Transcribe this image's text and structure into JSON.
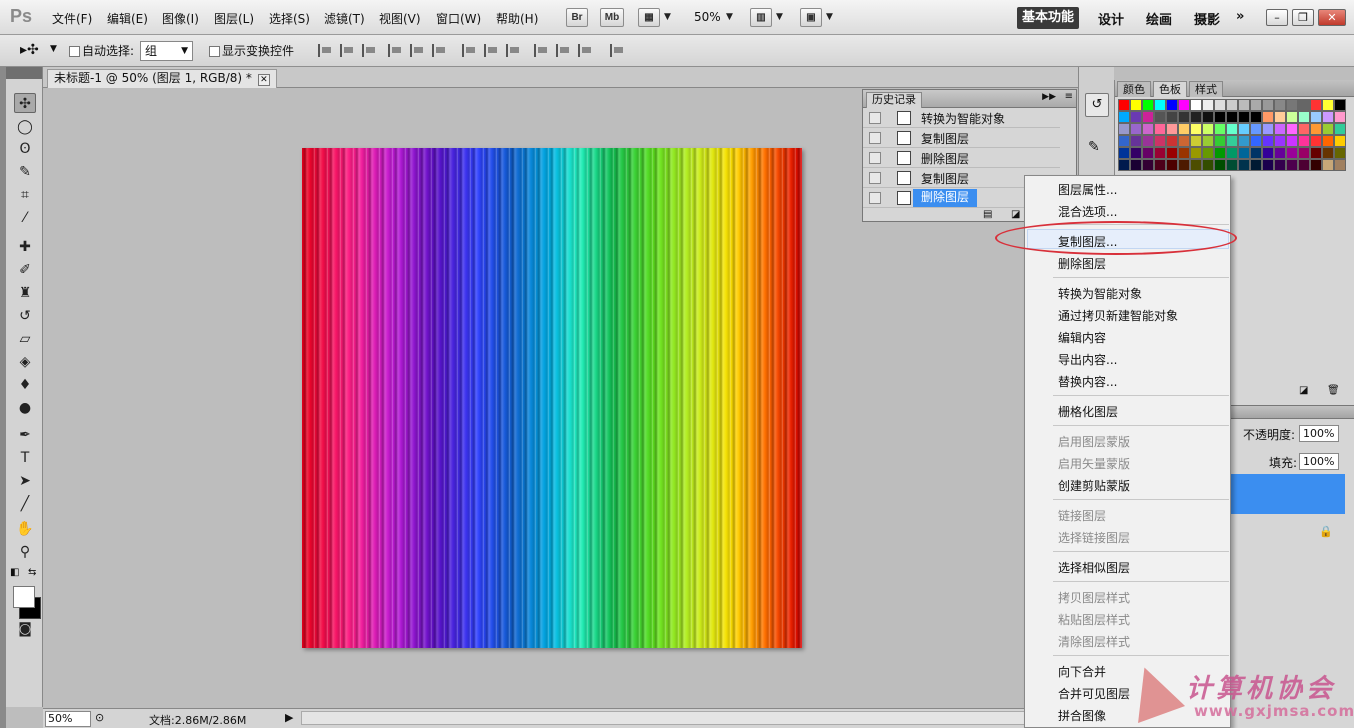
{
  "app": {
    "logo": "Ps"
  },
  "menus": [
    "文件(F)",
    "编辑(E)",
    "图像(I)",
    "图层(L)",
    "选择(S)",
    "滤镜(T)",
    "视图(V)",
    "窗口(W)",
    "帮助(H)"
  ],
  "appbar": {
    "bridge": "Br",
    "minibridge": "Mb",
    "zoom": "50%"
  },
  "workspaces": [
    "基本功能",
    "设计",
    "绘画",
    "摄影"
  ],
  "options": {
    "auto_select_label": "自动选择:",
    "auto_select_value": "组",
    "show_transform_label": "显示变换控件"
  },
  "document": {
    "tab_title": "未标题-1 @ 50% (图层 1, RGB/8) *"
  },
  "status": {
    "zoom": "50%",
    "doc_size": "文档:2.86M/2.86M"
  },
  "history": {
    "title": "历史记录",
    "items": [
      "转换为智能对象",
      "复制图层",
      "删除图层",
      "复制图层",
      "删除图层"
    ],
    "selected_index": 4
  },
  "swatches": {
    "tabs": [
      "颜色",
      "色板",
      "样式"
    ]
  },
  "layers": {
    "opacity_label": "不透明度:",
    "opacity": "100%",
    "fill_label": "填充:",
    "fill": "100%"
  },
  "context_menu": {
    "items": [
      {
        "label": "图层属性...",
        "disabled": false
      },
      {
        "label": "混合选项...",
        "disabled": false
      },
      {
        "label": "复制图层...",
        "disabled": false
      },
      {
        "label": "删除图层",
        "disabled": false
      },
      {
        "label": "转换为智能对象",
        "disabled": false
      },
      {
        "label": "通过拷贝新建智能对象",
        "disabled": false
      },
      {
        "label": "编辑内容",
        "disabled": false
      },
      {
        "label": "导出内容...",
        "disabled": false
      },
      {
        "label": "替换内容...",
        "disabled": false
      },
      {
        "label": "栅格化图层",
        "disabled": false
      },
      {
        "label": "启用图层蒙版",
        "disabled": true
      },
      {
        "label": "启用矢量蒙版",
        "disabled": true
      },
      {
        "label": "创建剪贴蒙版",
        "disabled": false
      },
      {
        "label": "链接图层",
        "disabled": true
      },
      {
        "label": "选择链接图层",
        "disabled": true
      },
      {
        "label": "选择相似图层",
        "disabled": false
      },
      {
        "label": "拷贝图层样式",
        "disabled": true
      },
      {
        "label": "粘贴图层样式",
        "disabled": true
      },
      {
        "label": "清除图层样式",
        "disabled": true
      },
      {
        "label": "向下合并",
        "disabled": false
      },
      {
        "label": "合并可见图层",
        "disabled": false
      },
      {
        "label": "拼合图像",
        "disabled": false
      }
    ],
    "highlighted_index": 2
  },
  "watermark": {
    "text": "计算机协会",
    "url": "www.gxjmsa.com"
  }
}
